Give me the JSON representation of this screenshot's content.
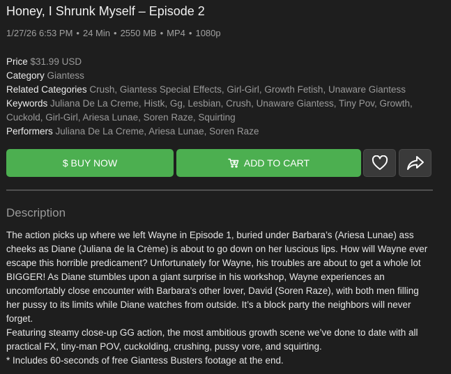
{
  "product": {
    "title": "Honey, I Shrunk Myself – Episode 2",
    "meta": {
      "date": "1/27/26 6:53 PM",
      "duration": "24 Min",
      "size": "2550 MB",
      "format": "MP4",
      "resolution": "1080p",
      "separator": "•"
    },
    "price_label": "Price",
    "price_value": "$31.99 USD",
    "category_label": "Category",
    "category_value": "Giantess",
    "related_label": "Related Categories",
    "related_value": "Crush, Giantess Special Effects, Girl-Girl, Growth Fetish, Unaware Giantess",
    "keywords_label": "Keywords",
    "keywords_value": "Juliana De La Creme, Histk, Gg, Lesbian, Crush, Unaware Giantess, Tiny Pov, Growth, Cuckold, Girl-Girl, Ariesa Lunae, Soren Raze, Squirting",
    "performers_label": "Performers",
    "performers_value": "Juliana De La Creme, Ariesa Lunae, Soren Raze"
  },
  "actions": {
    "buy_label": "$ BUY NOW",
    "cart_label": "ADD TO CART",
    "cart_icon": "cart-icon",
    "favorite_icon": "heart-icon",
    "share_icon": "share-icon"
  },
  "description": {
    "heading": "Description",
    "paragraphs": [
      "The action picks up where we left Wayne in Episode 1, buried under Barbara’s (Ariesa Lunae) ass cheeks as Diane (Juliana de la Crème) is about to go down on her luscious lips. How will Wayne ever escape this horrible predicament? Unfortunately for Wayne, his troubles are about to get a whole lot BIGGER! As Diane stumbles upon a giant surprise in his workshop, Wayne experiences an uncomfortably close encounter with Barbara’s other lover, David (Soren Raze), with both men filling her pussy to its limits while Diane watches from outside. It’s a block party the neighbors will never forget.",
      "Featuring steamy close-up GG action, the most ambitious growth scene we’ve done to date with all practical FX, tiny-man POV, cuckolding, crushing, pussy vore, and squirting.",
      "* Includes 60-seconds of free Giantess Busters footage at the end."
    ]
  },
  "colors": {
    "background": "#1e1e1e",
    "button_green": "#4caf50",
    "muted_text": "#9a9a9a"
  }
}
